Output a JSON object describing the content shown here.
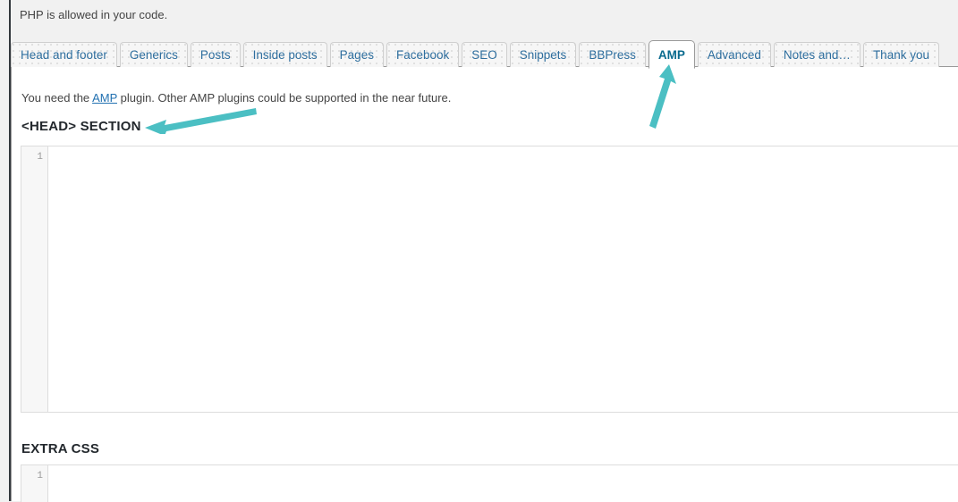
{
  "colors": {
    "page_bg": "#f1f1f1",
    "panel_bg": "#ffffff",
    "tab_text": "#2e6e9e",
    "tab_active_text": "#0a6a8e",
    "link": "#2271b1",
    "annotation_arrow": "#4bbfc3",
    "admin_edge": "#32373c",
    "editor_gutter": "#f7f7f7",
    "editor_border": "#dddddd"
  },
  "header": {
    "php_note": "PHP is allowed in your code."
  },
  "tabs": [
    {
      "label": "Head and footer",
      "name": "tab-head-and-footer",
      "active": false
    },
    {
      "label": "Generics",
      "name": "tab-generics",
      "active": false
    },
    {
      "label": "Posts",
      "name": "tab-posts",
      "active": false
    },
    {
      "label": "Inside posts",
      "name": "tab-inside-posts",
      "active": false
    },
    {
      "label": "Pages",
      "name": "tab-pages",
      "active": false
    },
    {
      "label": "Facebook",
      "name": "tab-facebook",
      "active": false
    },
    {
      "label": "SEO",
      "name": "tab-seo",
      "active": false
    },
    {
      "label": "Snippets",
      "name": "tab-snippets",
      "active": false
    },
    {
      "label": "BBPress",
      "name": "tab-bbpress",
      "active": false
    },
    {
      "label": "AMP",
      "name": "tab-amp",
      "active": true
    },
    {
      "label": "Advanced",
      "name": "tab-advanced",
      "active": false
    },
    {
      "label": "Notes and…",
      "name": "tab-notes-and",
      "active": false
    },
    {
      "label": "Thank you",
      "name": "tab-thank-you",
      "active": false
    }
  ],
  "panel": {
    "note_before_link": "You need the ",
    "note_link_text": "AMP",
    "note_after_link": " plugin. Other AMP plugins could be supported in the near future."
  },
  "sections": [
    {
      "title": "<HEAD> SECTION",
      "editor": {
        "line_number": "1",
        "value": ""
      }
    },
    {
      "title": "EXTRA CSS",
      "editor": {
        "line_number": "1",
        "value": ""
      }
    }
  ],
  "annotations": [
    {
      "name": "arrow-to-amp-tab",
      "points_at": "AMP",
      "direction": "up-right"
    },
    {
      "name": "arrow-to-head-section",
      "points_at": "<HEAD> SECTION",
      "direction": "left"
    }
  ]
}
